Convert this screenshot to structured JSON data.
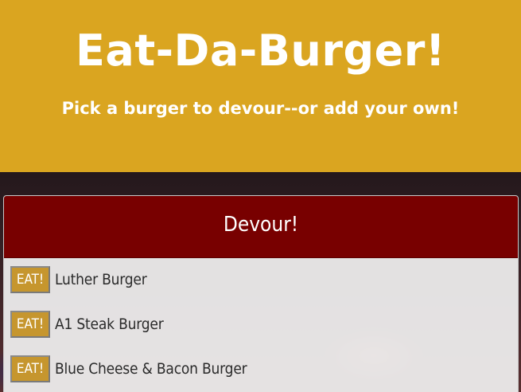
{
  "header": {
    "title": "Eat-Da-Burger!",
    "subtitle": "Pick a burger to devour--or add your own!"
  },
  "devour_panel": {
    "heading": "Devour!",
    "eat_label": "EAT!",
    "burgers": [
      {
        "name": "Luther Burger"
      },
      {
        "name": "A1 Steak Burger"
      },
      {
        "name": "Blue Cheese & Bacon Burger"
      }
    ]
  },
  "colors": {
    "jumbotron": "#daa520",
    "panel_header": "#780000",
    "eat_button": "#c6962e"
  }
}
